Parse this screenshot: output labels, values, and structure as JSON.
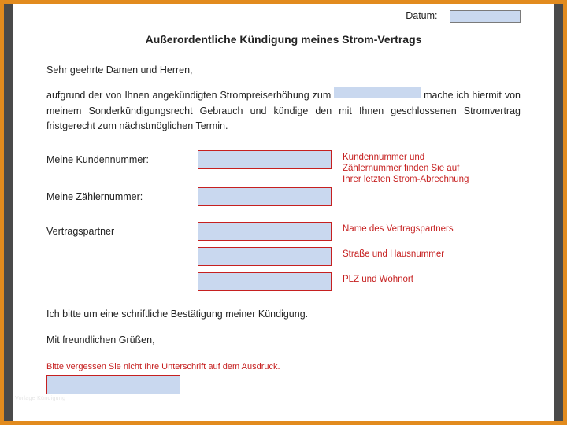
{
  "header": {
    "date_label": "Datum:"
  },
  "title": "Außerordentliche Kündigung meines Strom-Vertrags",
  "salutation": "Sehr geehrte Damen und Herren,",
  "paragraph": {
    "part1": "aufgrund der von Ihnen angekündigten Strompreiserhöhung zum ",
    "part2": " mache ich hiermit von meinem Sonderkündigungsrecht Gebrauch und kündige den mit Ihnen geschlossenen Stromvertrag fristgerecht zum nächstmöglichen Termin."
  },
  "fields": {
    "kundennummer_label": "Meine Kundennummer:",
    "zaehlernummer_label": "Meine Zählernummer:",
    "vertragspartner_label": "Vertragspartner",
    "hint_kundennummer": "Kundennummer und Zählernummer finden Sie auf Ihrer letzten Strom-Abrechnung",
    "hint_name": "Name des Vertragspartners",
    "hint_strasse": "Straße und Hausnummer",
    "hint_plz": "PLZ und Wohnort"
  },
  "confirm": "Ich bitte um eine schriftliche Bestätigung meiner Kündigung.",
  "closing": "Mit freundlichen Grüßen,",
  "signature_hint": "Bitte vergessen Sie nicht Ihre Unterschrift auf dem Ausdruck.",
  "watermark": "Vorlage Kündigung"
}
